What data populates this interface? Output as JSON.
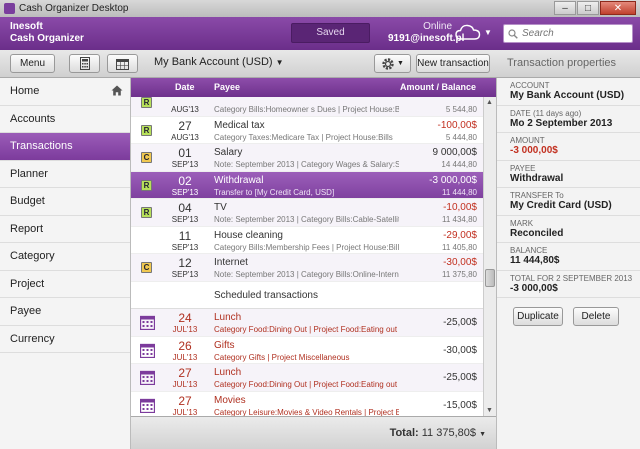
{
  "window": {
    "title": "Cash Organizer Desktop",
    "min": "–",
    "max": "□",
    "close": "✕"
  },
  "header": {
    "brand_line1": "Inesoft",
    "brand_line2": "Cash Organizer",
    "saved": "Saved",
    "online_label": "Online",
    "email": "9191@inesoft.pl",
    "search_placeholder": "Search"
  },
  "toolbar": {
    "menu": "Menu",
    "account": "My Bank Account (USD)",
    "new_transaction": "New transaction",
    "properties_title": "Transaction properties"
  },
  "sidebar": [
    "Home",
    "Accounts",
    "Transactions",
    "Planner",
    "Budget",
    "Report",
    "Category",
    "Project",
    "Payee",
    "Currency"
  ],
  "columns": {
    "date": "Date",
    "payee": "Payee",
    "amount": "Amount / Balance"
  },
  "transactions": [
    {
      "mark": "R",
      "day": "",
      "mon": "AUG'13",
      "payee": "",
      "note": "Category Bills:Homeowner s Dues | Project House:Bills",
      "amount": "",
      "balance": "5 544,80"
    },
    {
      "mark": "R",
      "day": "27",
      "mon": "AUG'13",
      "payee": "Medical tax",
      "note": "Category Taxes:Medicare Tax | Project House:Bills",
      "amount": "-100,00$",
      "balance": "5 444,80"
    },
    {
      "mark": "C",
      "day": "01",
      "mon": "SEP'13",
      "payee": "Salary",
      "note": "Note: September 2013 | Category Wages & Salary:Sala...",
      "amount": "9 000,00$",
      "balance": "14 444,80"
    },
    {
      "mark": "R",
      "day": "02",
      "mon": "SEP'13",
      "payee": "Withdrawal",
      "note": "Transfer to [My Credit Card, USD]",
      "amount": "-3 000,00$",
      "balance": "11 444,80"
    },
    {
      "mark": "R",
      "day": "04",
      "mon": "SEP'13",
      "payee": "TV",
      "note": "Note: September 2013 | Category Bills:Cable-Satellite T...",
      "amount": "-10,00$",
      "balance": "11 434,80"
    },
    {
      "mark": "",
      "day": "11",
      "mon": "SEP'13",
      "payee": "House cleaning",
      "note": "Category Bills:Membership Fees | Project House:Bills",
      "amount": "-29,00$",
      "balance": "11 405,80"
    },
    {
      "mark": "C",
      "day": "12",
      "mon": "SEP'13",
      "payee": "Internet",
      "note": "Note: September 2013 | Category Bills:Online-Internet ...",
      "amount": "-30,00$",
      "balance": "11 375,80"
    }
  ],
  "scheduled_title": "Scheduled transactions",
  "scheduled": [
    {
      "day": "24",
      "mon": "JUL'13",
      "payee": "Lunch",
      "note": "Category Food:Dining Out | Project Food:Eating out",
      "amount": "-25,00$"
    },
    {
      "day": "26",
      "mon": "JUL'13",
      "payee": "Gifts",
      "note": "Category Gifts | Project Miscellaneous",
      "amount": "-30,00$"
    },
    {
      "day": "27",
      "mon": "JUL'13",
      "payee": "Lunch",
      "note": "Category Food:Dining Out | Project Food:Eating out",
      "amount": "-25,00$"
    },
    {
      "day": "27",
      "mon": "JUL'13",
      "payee": "Movies",
      "note": "Category Leisure:Movies & Video Rentals | Project Ent...",
      "amount": "-15,00$"
    }
  ],
  "total": {
    "label": "Total:",
    "value": "11 375,80$"
  },
  "properties": [
    {
      "k": "ACCOUNT",
      "v": "My Bank Account (USD)",
      "red": false
    },
    {
      "k": "DATE (11 days ago)",
      "v": "Mo 2 September 2013",
      "red": false
    },
    {
      "k": "AMOUNT",
      "v": "-3 000,00$",
      "red": true
    },
    {
      "k": "PAYEE",
      "v": "Withdrawal",
      "red": false
    },
    {
      "k": "TRANSFER To",
      "v": "My Credit Card (USD)",
      "red": false
    },
    {
      "k": "MARK",
      "v": "Reconciled",
      "red": false
    },
    {
      "k": "BALANCE",
      "v": "11 444,80$",
      "red": false
    },
    {
      "k": "TOTAL FOR 2 SEPTEMBER 2013",
      "v": "-3 000,00$",
      "red": false
    }
  ],
  "buttons": {
    "duplicate": "Duplicate",
    "delete": "Delete"
  },
  "colors": {
    "purple": "#7c3b9c",
    "red": "#c23020"
  },
  "selected_row": 3
}
